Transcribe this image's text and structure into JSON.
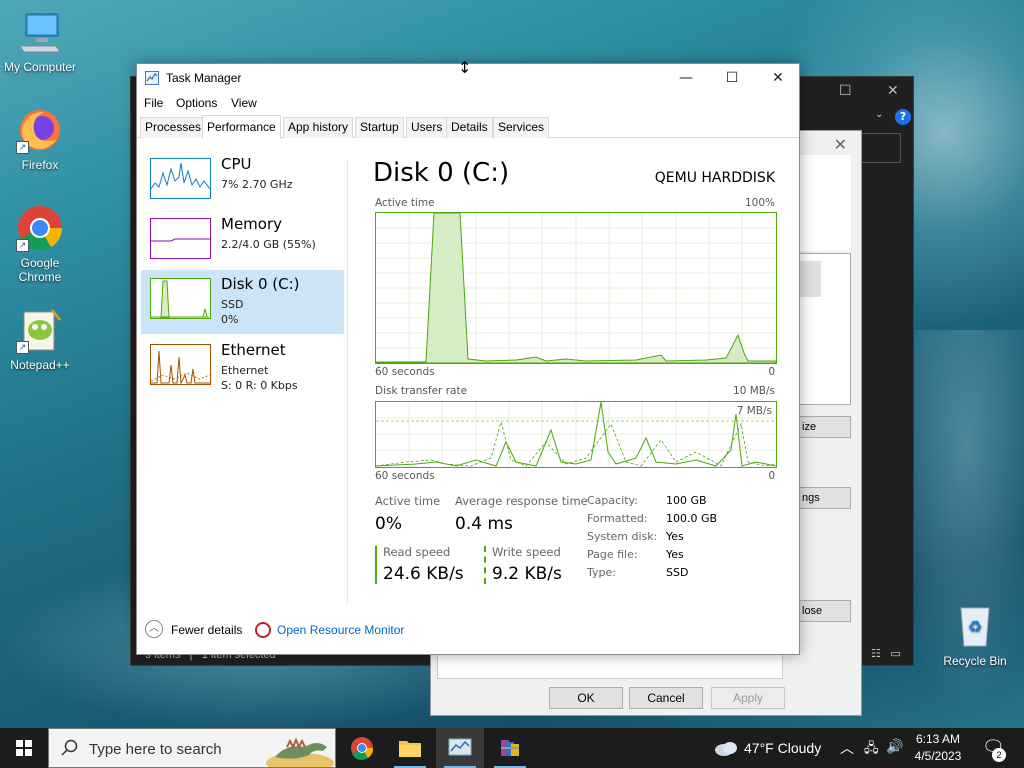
{
  "desktop": {
    "icons": [
      {
        "label": "My Computer"
      },
      {
        "label": "Firefox"
      },
      {
        "label": "Google Chrome"
      },
      {
        "label": "Notepad++"
      },
      {
        "label": "Recycle Bin"
      }
    ]
  },
  "background_explorer": {
    "status_items": "9 items",
    "status_selected": "1 item selected"
  },
  "properties_dialog": {
    "side_btn_1": "ize",
    "side_btn_2": "ngs",
    "side_btn_3": "lose",
    "ok": "OK",
    "cancel": "Cancel",
    "apply": "Apply"
  },
  "task_manager": {
    "title": "Task Manager",
    "menu": [
      "File",
      "Options",
      "View"
    ],
    "tabs": [
      "Processes",
      "Performance",
      "App history",
      "Startup",
      "Users",
      "Details",
      "Services"
    ],
    "active_tab": "Performance",
    "resources": [
      {
        "name": "CPU",
        "line1": "7% 2.70 GHz",
        "line2": "",
        "line3": "",
        "color": "#117dbb"
      },
      {
        "name": "Memory",
        "line1": "2.2/4.0 GB (55%)",
        "line2": "",
        "line3": "",
        "color": "#8b12ae"
      },
      {
        "name": "Disk 0 (C:)",
        "line1": "SSD",
        "line2": "0%",
        "line3": "",
        "color": "#4da60c"
      },
      {
        "name": "Ethernet",
        "line1": "Ethernet",
        "line2": "S: 0 R: 0 Kbps",
        "line3": "",
        "color": "#a74f01"
      }
    ],
    "disk": {
      "title": "Disk 0 (C:)",
      "model": "QEMU HARDDISK",
      "active_time_label": "Active time",
      "active_time_max": "100%",
      "graph1_left": "60 seconds",
      "graph1_right": "0",
      "transfer_label": "Disk transfer rate",
      "transfer_max": "10 MB/s",
      "transfer_marker": "7 MB/s",
      "graph2_left": "60 seconds",
      "graph2_right": "0",
      "stats": {
        "active_time_label": "Active time",
        "active_time_value": "0%",
        "avg_response_label": "Average response time",
        "avg_response_value": "0.4 ms",
        "read_label": "Read speed",
        "read_value": "24.6 KB/s",
        "write_label": "Write speed",
        "write_value": "9.2 KB/s"
      },
      "properties": [
        {
          "key": "Capacity:",
          "value": "100 GB"
        },
        {
          "key": "Formatted:",
          "value": "100.0 GB"
        },
        {
          "key": "System disk:",
          "value": "Yes"
        },
        {
          "key": "Page file:",
          "value": "Yes"
        },
        {
          "key": "Type:",
          "value": "SSD"
        }
      ]
    },
    "footer": {
      "fewer_details": "Fewer details",
      "open_monitor": "Open Resource Monitor"
    }
  },
  "taskbar": {
    "search_placeholder": "Type here to search",
    "weather": "47°F  Cloudy",
    "time": "6:13 AM",
    "date": "4/5/2023",
    "notification_count": "2"
  },
  "colors": {
    "disk_green": "#4da60c",
    "accent_blue": "#0066cc",
    "selection": "#cce4f7"
  }
}
